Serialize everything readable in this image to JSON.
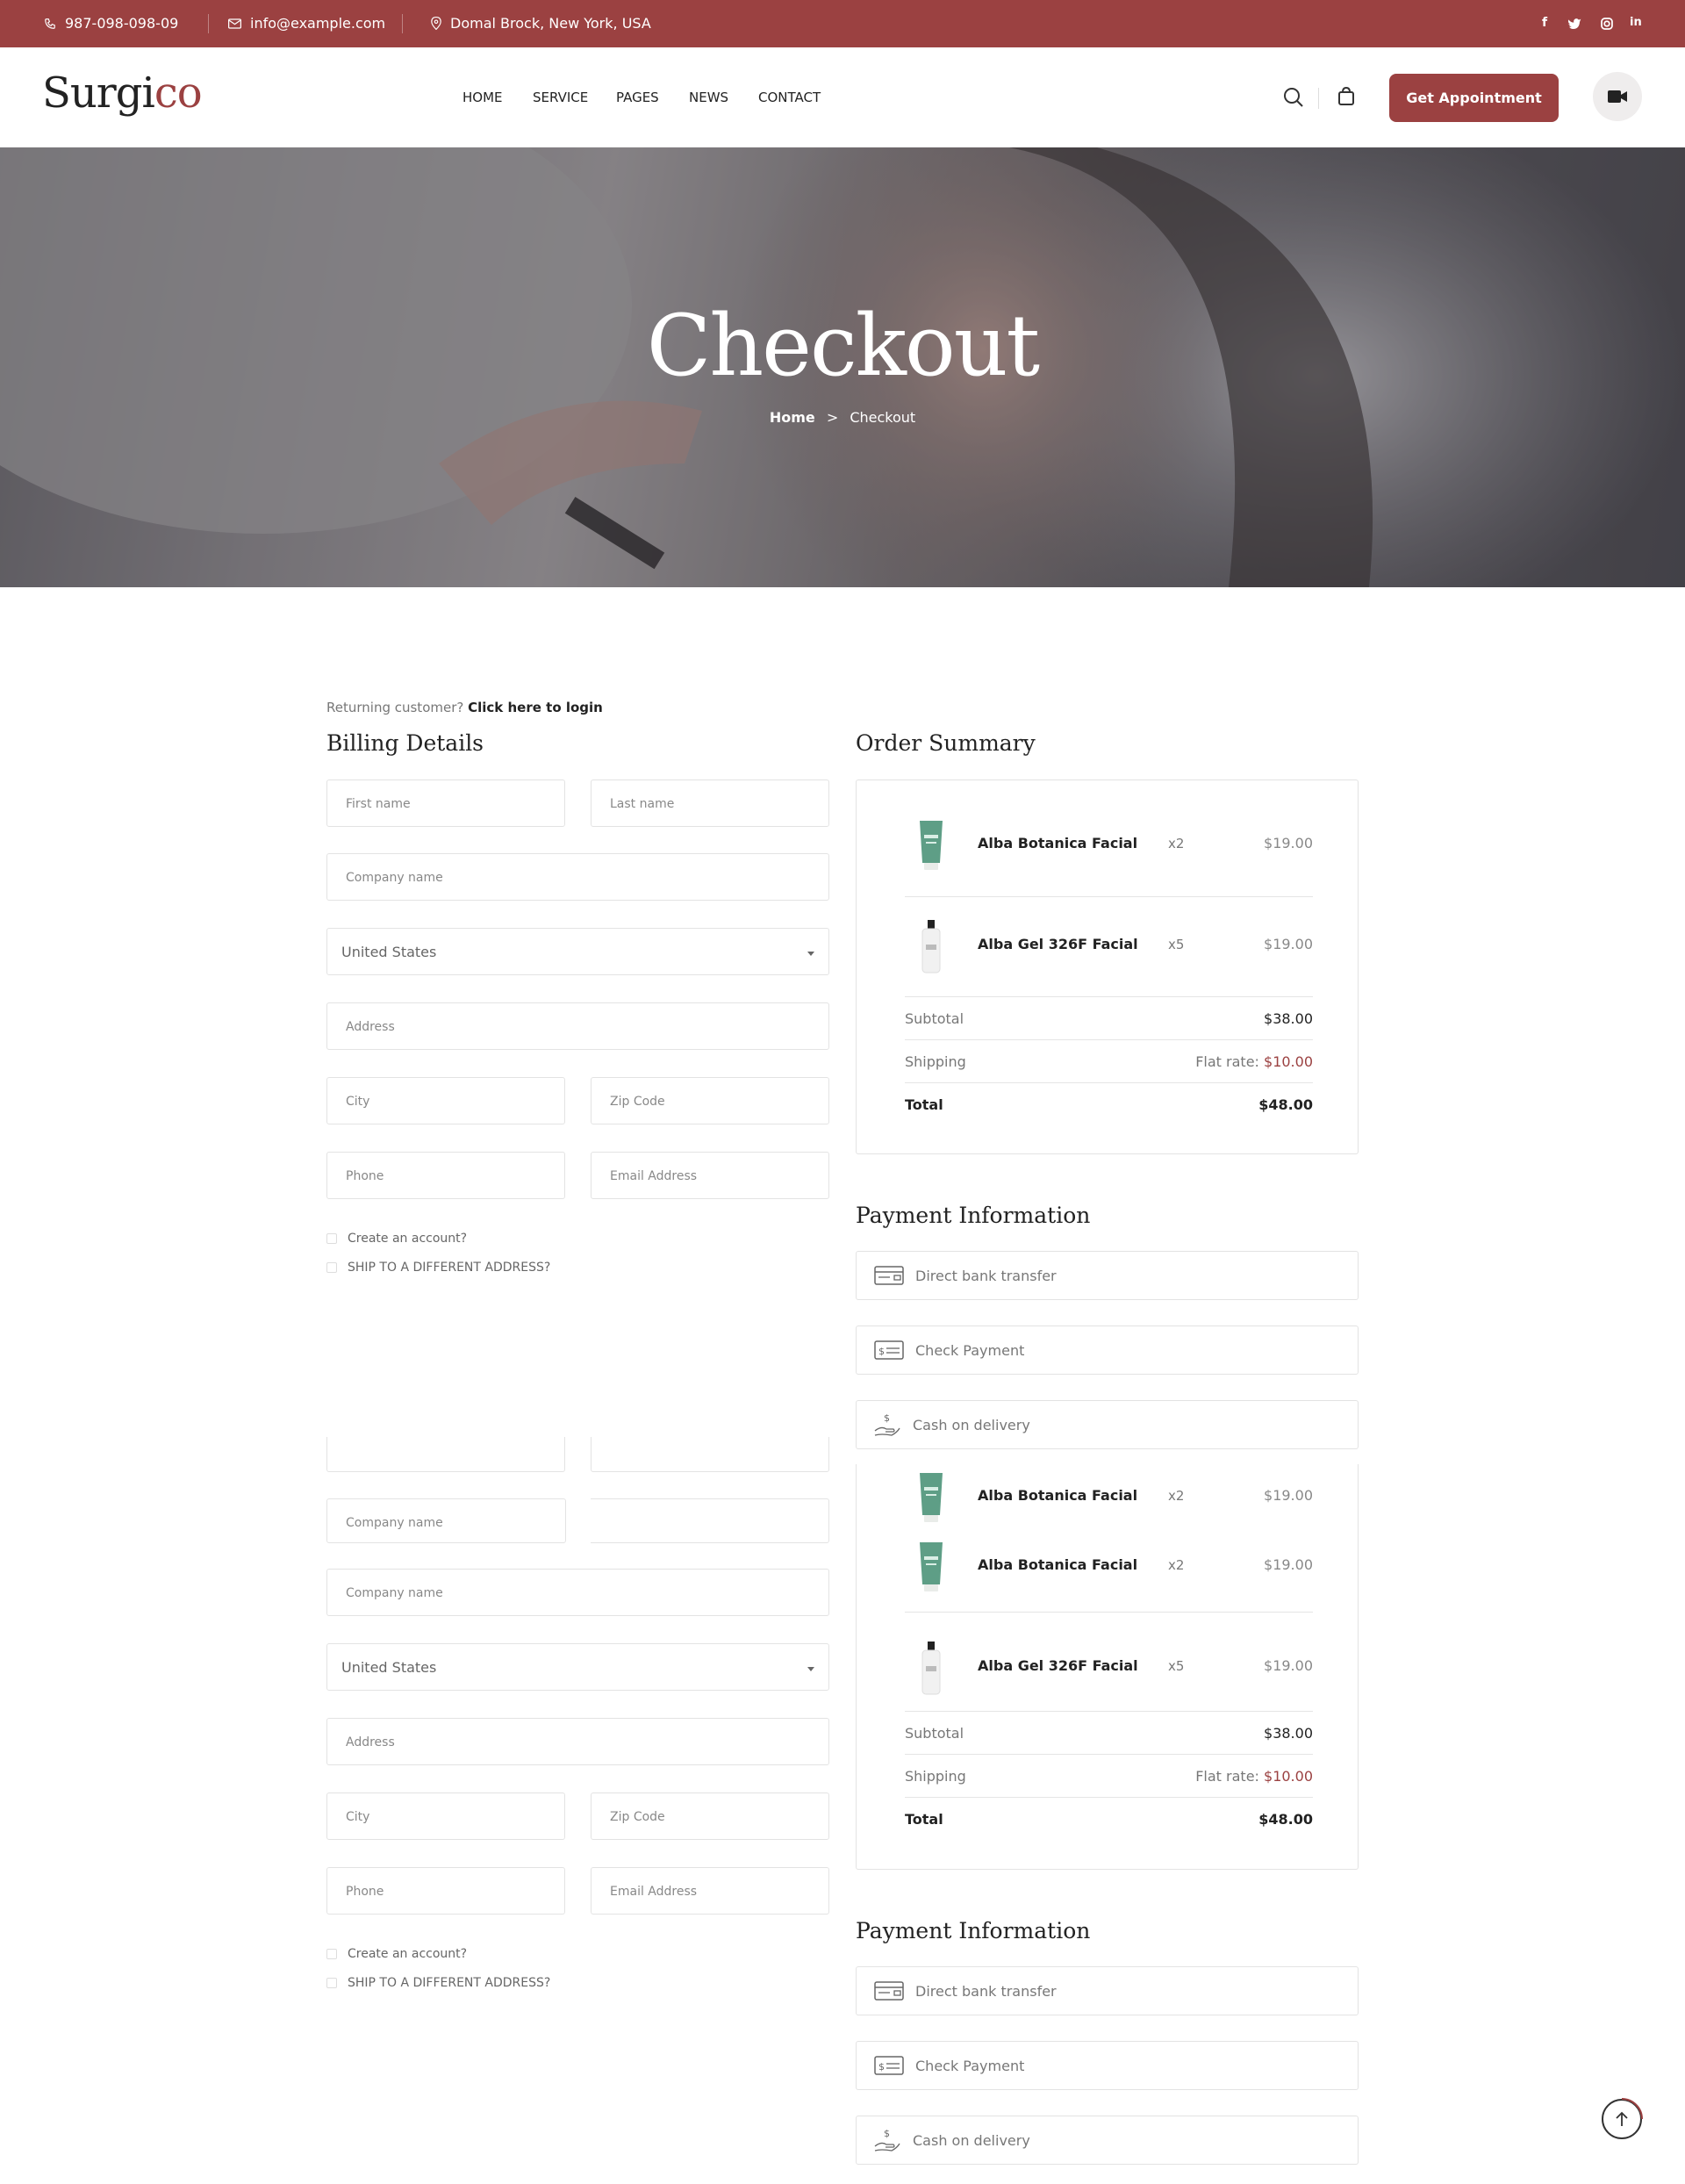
{
  "topbar": {
    "phone": "987-098-098-09",
    "email": "info@example.com",
    "address": "Domal Brock, New York, USA",
    "social": [
      "f",
      "t",
      "ig",
      "in"
    ]
  },
  "header": {
    "logo_main": "Surgi",
    "logo_accent": "co",
    "nav": [
      "HOME",
      "SERVICE",
      "PAGES",
      "NEWS",
      "CONTACT"
    ],
    "cta": "Get Appointment"
  },
  "hero": {
    "title": "Checkout",
    "crumb_home": "Home",
    "crumb_sep": ">",
    "crumb_current": "Checkout"
  },
  "returning": {
    "text": "Returning customer?",
    "link": "Click here to login"
  },
  "billing": {
    "title": "Billing Details",
    "first_name": "First name",
    "last_name": "Last name",
    "company": "Company name",
    "country": "United States",
    "address": "Address",
    "city": "City",
    "zip": "Zip Code",
    "phone": "Phone",
    "email": "Email Address",
    "create_account": "Create an account?",
    "ship_different": "SHIP TO A DIFFERENT ADDRESS?"
  },
  "order": {
    "title": "Order Summary",
    "items": [
      {
        "name": "Alba Botanica Facial",
        "qty": "x2",
        "price": "$19.00"
      },
      {
        "name": "Alba Gel 326F Facial",
        "qty": "x5",
        "price": "$19.00"
      }
    ],
    "subtotal_label": "Subtotal",
    "subtotal": "$38.00",
    "shipping_label": "Shipping",
    "shipping_prefix": "Flat rate:",
    "shipping": "$10.00",
    "total_label": "Total",
    "total": "$48.00"
  },
  "payment": {
    "title": "Payment Information",
    "methods": [
      "Direct bank transfer",
      "Check Payment",
      "Cash on delivery"
    ]
  },
  "colors": {
    "brand": "#9b4141",
    "tube": "#5e9e86",
    "bottle": "#f1f1f1"
  }
}
